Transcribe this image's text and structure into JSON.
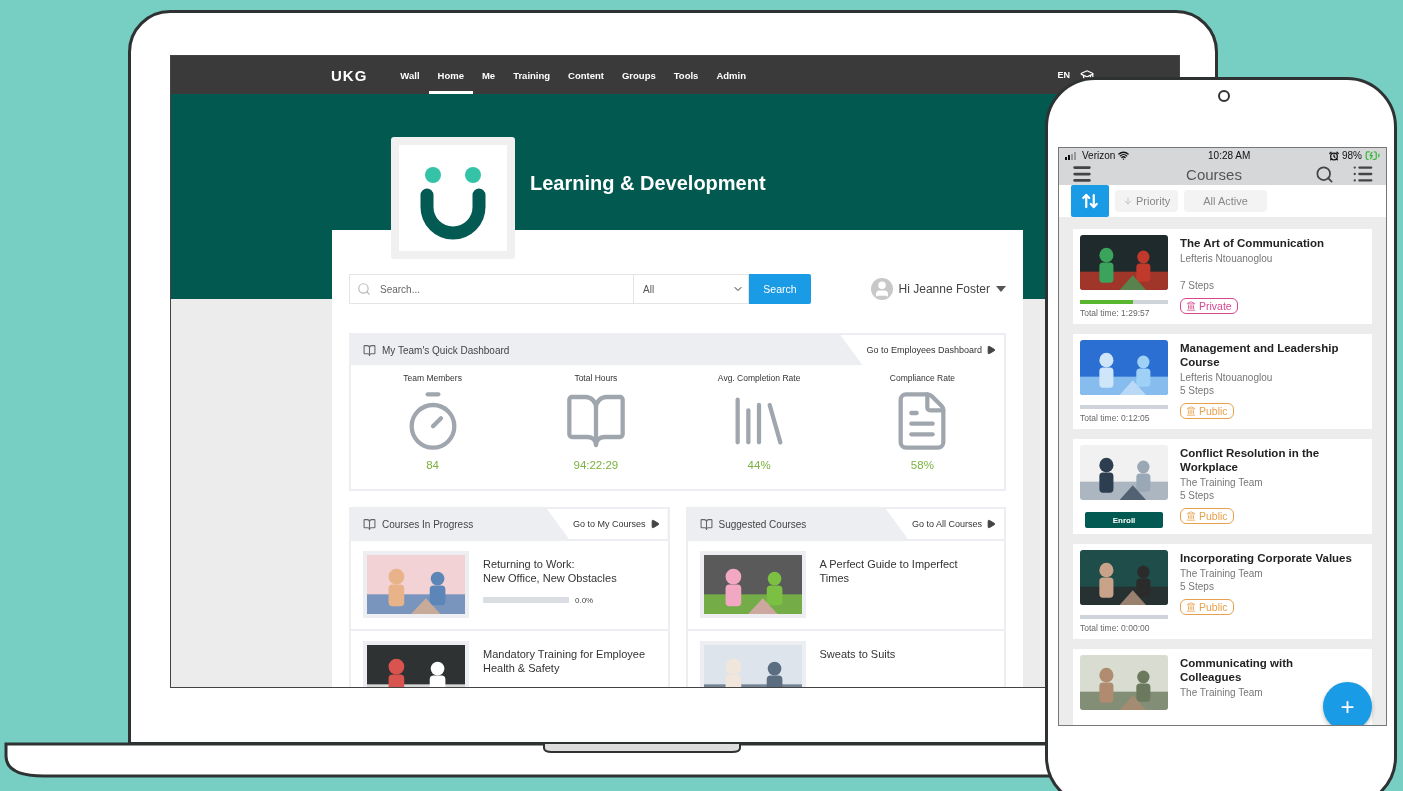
{
  "laptop": {
    "nav": {
      "logo": "UKG",
      "items": [
        {
          "label": "Wall",
          "selected": false
        },
        {
          "label": "Home",
          "selected": true
        },
        {
          "label": "Me",
          "selected": false
        },
        {
          "label": "Training",
          "selected": false
        },
        {
          "label": "Content",
          "selected": false
        },
        {
          "label": "Groups",
          "selected": false
        },
        {
          "label": "Tools",
          "selected": false
        },
        {
          "label": "Admin",
          "selected": false
        }
      ],
      "language": "EN"
    },
    "banner": {
      "title": "Learning & Development"
    },
    "search": {
      "placeholder": "Search...",
      "filter": "All",
      "button": "Search"
    },
    "user": {
      "greeting": "Hi Jeanne Foster"
    },
    "dashboard": {
      "title": "My Team's Quick Dashboard",
      "link": "Go to Employees Dashboard",
      "stats": [
        {
          "label": "Team Members",
          "value": "84",
          "kind": "stopwatch"
        },
        {
          "label": "Total Hours",
          "value": "94:22:29",
          "kind": "book"
        },
        {
          "label": "Avg. Completion Rate",
          "value": "44%",
          "kind": "books"
        },
        {
          "label": "Compliance Rate",
          "value": "58%",
          "kind": "document"
        }
      ]
    },
    "panels": [
      {
        "title": "Courses In Progress",
        "link": "Go to My Courses",
        "courses": [
          {
            "title": "Returning to Work:\nNew Office, New Obstacles",
            "kind": "progress",
            "level": 0,
            "reading": "0.0%"
          },
          {
            "title": "Mandatory Training for Employee Health & Safety",
            "kind": "plain"
          }
        ]
      },
      {
        "title": "Suggested Courses",
        "link": "Go to All Courses",
        "courses": [
          {
            "title": "A Perfect Guide to Imperfect Times",
            "kind": "plain"
          },
          {
            "title": "Sweats to Suits",
            "kind": "plain"
          }
        ]
      }
    ]
  },
  "phone": {
    "status": {
      "carrier": "Verizon",
      "time": "10:28 AM",
      "battery": "98%"
    },
    "header": {
      "title": "Courses"
    },
    "filters": [
      {
        "label": "Priority",
        "kind": "sort"
      },
      {
        "label": "All Active",
        "kind": "plain"
      }
    ],
    "courses": [
      {
        "title": "The Art of Communication",
        "author": "Lefteris Ntouanoglou",
        "steps": "7 Steps",
        "kind": "progress",
        "level": 0.6,
        "time": "Total time: 1:29:57",
        "tag": {
          "label": "Private",
          "color": "#d6478f"
        }
      },
      {
        "title": "Management and Leadership Course",
        "author": "Lefteris Ntouanoglou",
        "steps": "5 Steps",
        "kind": "progress",
        "level": 0,
        "time": "Total time: 0:12:05",
        "tag": {
          "label": "Public",
          "color": "#e8a04c"
        }
      },
      {
        "title": "Conflict Resolution in the Workplace",
        "author": "The Training Team",
        "steps": "5 Steps",
        "kind": "enroll",
        "action": "Enroll",
        "tag": {
          "label": "Public",
          "color": "#e8a04c"
        }
      },
      {
        "title": "Incorporating Corporate Values",
        "author": "The Training Team",
        "steps": "5 Steps",
        "kind": "progress",
        "level": 0,
        "time": "Total time: 0:00:00",
        "tag": {
          "label": "Public",
          "color": "#e8a04c"
        }
      },
      {
        "title": "Communicating with Colleagues",
        "author": "The Training Team",
        "kind": "plain"
      }
    ],
    "fab": "+"
  }
}
